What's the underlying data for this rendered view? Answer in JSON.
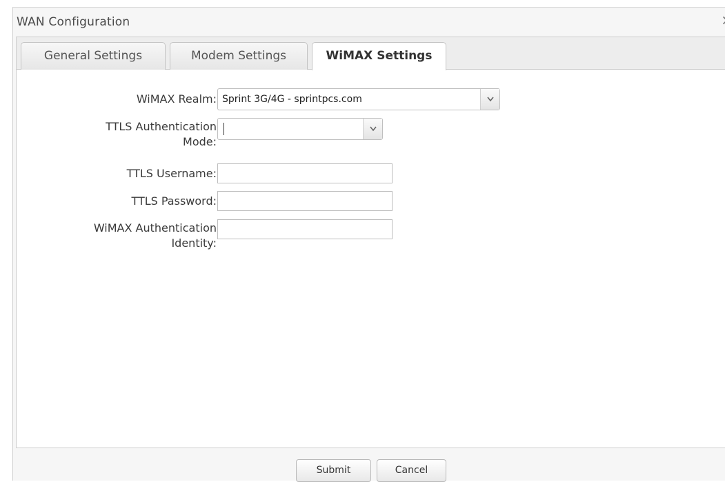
{
  "window": {
    "title": "WAN Configuration",
    "close_glyph": "×"
  },
  "tabs": [
    {
      "label": "General Settings",
      "active": false
    },
    {
      "label": "Modem Settings",
      "active": false
    },
    {
      "label": "WiMAX Settings",
      "active": true
    }
  ],
  "form": {
    "realm": {
      "label": "WiMAX Realm:",
      "selected": "Sprint 3G/4G - sprintpcs.com"
    },
    "ttls_mode": {
      "label": "TTLS Authentication\nMode:",
      "selected": ""
    },
    "ttls_username": {
      "label": "TTLS Username:",
      "value": ""
    },
    "ttls_password": {
      "label": "TTLS Password:",
      "value": ""
    },
    "wimax_identity": {
      "label": "WiMAX Authentication\nIdentity:",
      "value": ""
    }
  },
  "footer": {
    "submit_label": "Submit",
    "cancel_label": "Cancel"
  },
  "icons": {
    "dropdown": "chevron-down-icon",
    "close": "close-icon"
  }
}
